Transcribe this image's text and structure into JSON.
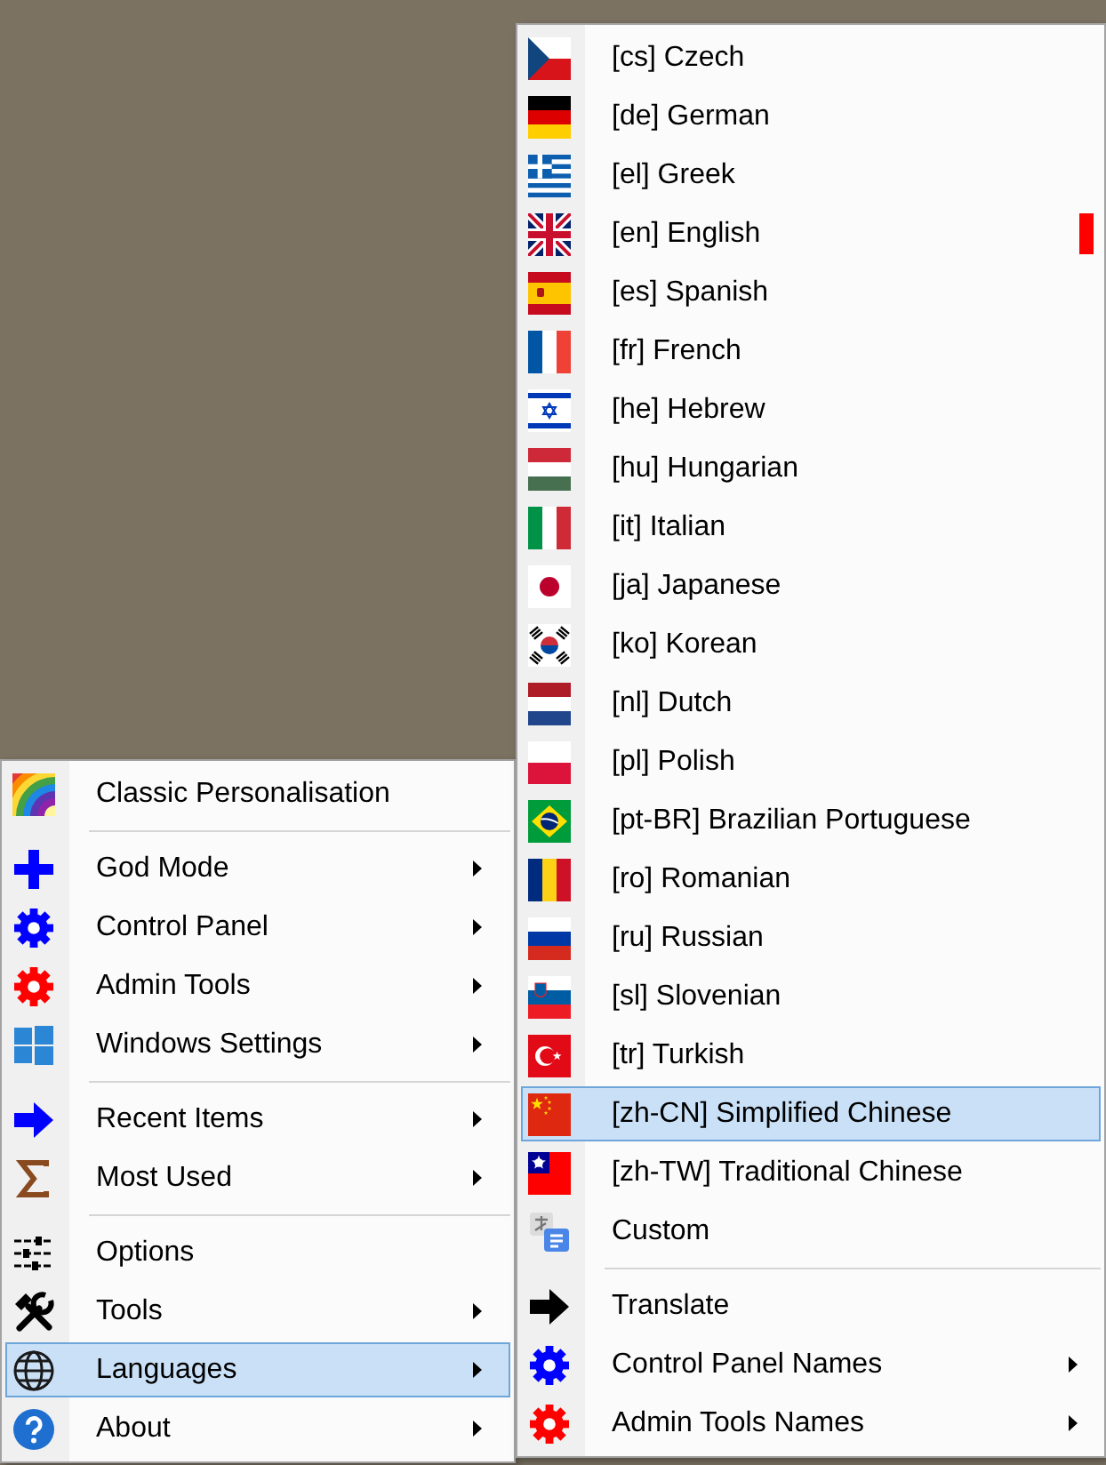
{
  "left_menu": {
    "groups": [
      [
        {
          "label": "Classic Personalisation",
          "submenu": false,
          "selected": false
        }
      ],
      [
        {
          "label": "God Mode",
          "submenu": true,
          "selected": false
        },
        {
          "label": "Control Panel",
          "submenu": true,
          "selected": false
        },
        {
          "label": "Admin Tools",
          "submenu": true,
          "selected": false
        },
        {
          "label": "Windows Settings",
          "submenu": true,
          "selected": false
        }
      ],
      [
        {
          "label": "Recent Items",
          "submenu": true,
          "selected": false
        },
        {
          "label": "Most Used",
          "submenu": true,
          "selected": false
        }
      ],
      [
        {
          "label": "Options",
          "submenu": false,
          "selected": false
        },
        {
          "label": "Tools",
          "submenu": true,
          "selected": false
        },
        {
          "label": "Languages",
          "submenu": true,
          "selected": true
        },
        {
          "label": "About",
          "submenu": true,
          "selected": false
        }
      ]
    ]
  },
  "languages_menu": {
    "groups": [
      [
        {
          "label": "[cs] Czech",
          "selected": false,
          "marked": false
        },
        {
          "label": "[de] German",
          "selected": false,
          "marked": false
        },
        {
          "label": "[el] Greek",
          "selected": false,
          "marked": false
        },
        {
          "label": "[en] English",
          "selected": false,
          "marked": true
        },
        {
          "label": "[es] Spanish",
          "selected": false,
          "marked": false
        },
        {
          "label": "[fr] French",
          "selected": false,
          "marked": false
        },
        {
          "label": "[he] Hebrew",
          "selected": false,
          "marked": false
        },
        {
          "label": "[hu] Hungarian",
          "selected": false,
          "marked": false
        },
        {
          "label": "[it] Italian",
          "selected": false,
          "marked": false
        },
        {
          "label": "[ja] Japanese",
          "selected": false,
          "marked": false
        },
        {
          "label": "[ko] Korean",
          "selected": false,
          "marked": false
        },
        {
          "label": "[nl] Dutch",
          "selected": false,
          "marked": false
        },
        {
          "label": "[pl] Polish",
          "selected": false,
          "marked": false
        },
        {
          "label": "[pt-BR] Brazilian Portuguese",
          "selected": false,
          "marked": false
        },
        {
          "label": "[ro] Romanian",
          "selected": false,
          "marked": false
        },
        {
          "label": "[ru] Russian",
          "selected": false,
          "marked": false
        },
        {
          "label": "[sl] Slovenian",
          "selected": false,
          "marked": false
        },
        {
          "label": "[tr] Turkish",
          "selected": false,
          "marked": false
        },
        {
          "label": "[zh-CN] Simplified Chinese",
          "selected": true,
          "marked": false
        },
        {
          "label": "[zh-TW] Traditional Chinese",
          "selected": false,
          "marked": false
        },
        {
          "label": "Custom",
          "selected": false,
          "marked": false
        }
      ],
      [
        {
          "label": "Translate",
          "submenu": false,
          "selected": false
        },
        {
          "label": "Control Panel Names",
          "submenu": true,
          "selected": false
        },
        {
          "label": "Admin Tools Names",
          "submenu": true,
          "selected": false
        }
      ]
    ]
  }
}
